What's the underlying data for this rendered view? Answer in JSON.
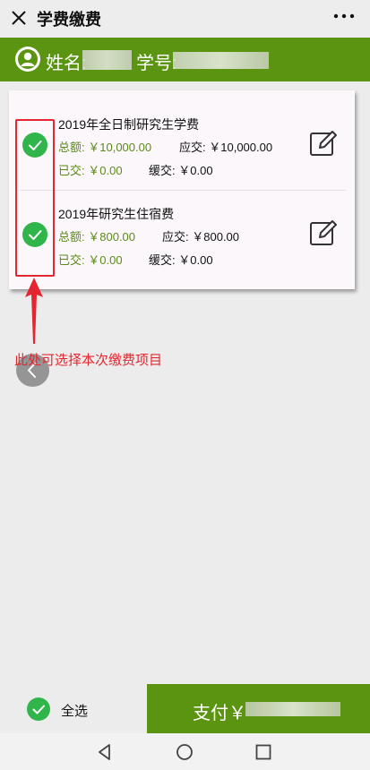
{
  "topbar": {
    "title": "学费缴费",
    "close_icon": "close-icon",
    "more_icon": "more-icon"
  },
  "student": {
    "name_label": "姓名:",
    "id_label": "学号:"
  },
  "fees": [
    {
      "name": "2019年全日制研究生学费",
      "total_label": "总额:",
      "total_value": "￥10,000.00",
      "due_label": "应交:",
      "due_value": "￥10,000.00",
      "paid_label": "已交:",
      "paid_value": "￥0.00",
      "deferred_label": "缓交:",
      "deferred_value": "￥0.00",
      "checked": true
    },
    {
      "name": "2019年研究生住宿费",
      "total_label": "总额:",
      "total_value": "￥800.00",
      "due_label": "应交:",
      "due_value": "￥800.00",
      "paid_label": "已交:",
      "paid_value": "￥0.00",
      "deferred_label": "缓交:",
      "deferred_value": "￥0.00",
      "checked": true
    }
  ],
  "annotation": {
    "text": "此处可选择本次缴费项目",
    "color": "#e3262f"
  },
  "bottom": {
    "select_all_label": "全选",
    "pay_label": "支付￥"
  },
  "colors": {
    "brand_green": "#5b9411",
    "check_green": "#2fb54a",
    "annotation_red": "#e3262f"
  }
}
